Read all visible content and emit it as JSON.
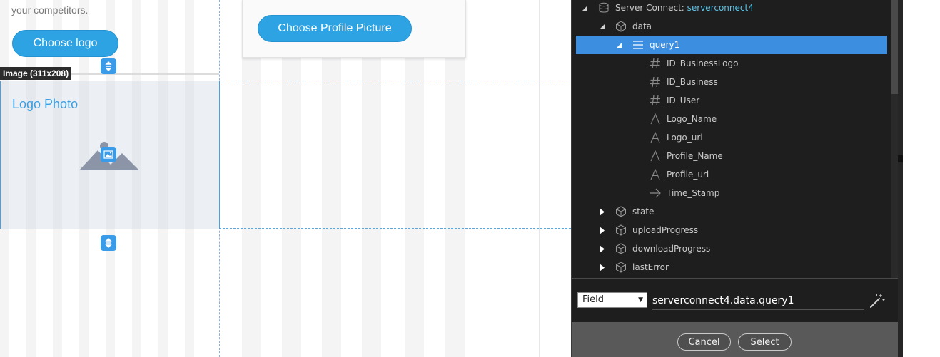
{
  "canvas": {
    "competitors_text": "your competitors.",
    "choose_logo_label": "Choose logo",
    "choose_profile_label": "Choose Profile Picture",
    "image_tag": "Image (311x208)",
    "logo_photo_title": "Logo Photo"
  },
  "tree": {
    "root": {
      "prefix": "Server Connect: ",
      "name": "serverconnect4"
    },
    "data": "data",
    "query": "query1",
    "fields": [
      {
        "label": "ID_BusinessLogo",
        "icon": "hash-icon"
      },
      {
        "label": "ID_Business",
        "icon": "hash-icon"
      },
      {
        "label": "ID_User",
        "icon": "hash-icon"
      },
      {
        "label": "Logo_Name",
        "icon": "text-icon"
      },
      {
        "label": "Logo_url",
        "icon": "text-icon"
      },
      {
        "label": "Profile_Name",
        "icon": "text-icon"
      },
      {
        "label": "Profile_url",
        "icon": "text-icon"
      },
      {
        "label": "Time_Stamp",
        "icon": "arrow-icon"
      }
    ],
    "siblings": [
      "state",
      "uploadProgress",
      "downloadProgress",
      "lastError"
    ]
  },
  "expression": {
    "type_select": "Field",
    "value": "serverconnect4.data.query1"
  },
  "footer": {
    "cancel": "Cancel",
    "select": "Select"
  },
  "colors": {
    "accent_blue": "#2ea3e3",
    "selection_blue": "#3b8ee0",
    "panel_bg": "#1e1e1e",
    "link_cyan": "#5cc4e8"
  }
}
